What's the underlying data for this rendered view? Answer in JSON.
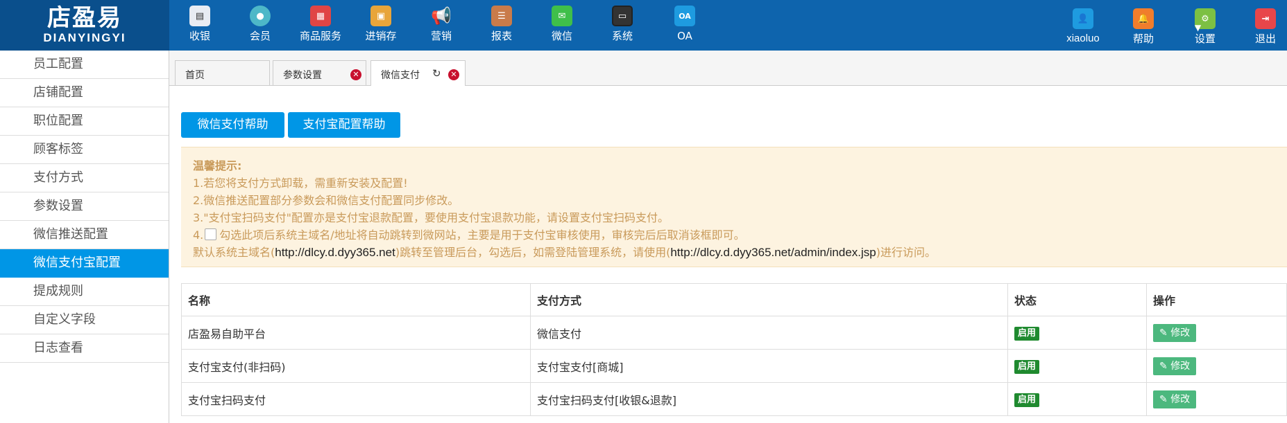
{
  "logo": {
    "cn": "店盈易",
    "en": "DIANYINGYI"
  },
  "nav": [
    {
      "label": "收银",
      "icon": "cash-register-icon",
      "color": "#4a6fa5"
    },
    {
      "label": "会员",
      "icon": "member-icon",
      "color": "#4db8c8"
    },
    {
      "label": "商品服务",
      "icon": "goods-icon",
      "color": "#e04545"
    },
    {
      "label": "进销存",
      "icon": "inventory-icon",
      "color": "#e8a53a"
    },
    {
      "label": "营销",
      "icon": "megaphone-icon",
      "color": "#ffffff"
    },
    {
      "label": "报表",
      "icon": "report-icon",
      "color": "#c97b4a"
    },
    {
      "label": "微信",
      "icon": "wechat-icon",
      "color": "#3fbf4a"
    },
    {
      "label": "系统",
      "icon": "monitor-icon",
      "color": "#333333"
    },
    {
      "label": "OA",
      "icon": "oa-icon",
      "color": "#1e9be0"
    }
  ],
  "right_nav": [
    {
      "label": "xiaoluo",
      "icon": "user-icon",
      "color": "#1e9be0"
    },
    {
      "label": "帮助",
      "icon": "bell-icon",
      "color": "#f07d2c"
    },
    {
      "label": "设置",
      "icon": "gear-icon",
      "color": "#7cc043"
    },
    {
      "label": "退出",
      "icon": "logout-icon",
      "color": "#e8464a"
    }
  ],
  "sidebar": [
    "员工配置",
    "店铺配置",
    "职位配置",
    "顾客标签",
    "支付方式",
    "参数设置",
    "微信推送配置",
    "微信支付宝配置",
    "提成规则",
    "自定义字段",
    "日志查看"
  ],
  "sidebar_active": "微信支付宝配置",
  "tabs": [
    {
      "label": "首页"
    },
    {
      "label": "参数设置"
    },
    {
      "label": "微信支付"
    }
  ],
  "buttons": {
    "wechat_help": "微信支付帮助",
    "alipay_help": "支付宝配置帮助"
  },
  "notice": {
    "title": "温馨提示:",
    "line1": "1.若您将支付方式卸载，需重新安装及配置!",
    "line2": "2.微信推送配置部分参数会和微信支付配置同步修改。",
    "line3": "3.\"支付宝扫码支付\"配置亦是支付宝退款配置，要使用支付宝退款功能，请设置支付宝扫码支付。",
    "line4_prefix": "4.",
    "line4_text": "勾选此项后系统主域名/地址将自动跳转到微网站，主要是用于支付宝审核使用，审核完后后取消该框即可。",
    "line5_a": "默认系统主域名(",
    "line5_url1": "http://dlcy.d.dyy365.net",
    "line5_b": ")跳转至管理后台，勾选后，如需登陆管理系统，请使用(",
    "line5_url2": "http://dlcy.d.dyy365.net/admin/index.jsp",
    "line5_c": ")进行访问。"
  },
  "table": {
    "headers": [
      "名称",
      "支付方式",
      "状态",
      "操作"
    ],
    "rows": [
      {
        "name": "店盈易自助平台",
        "method": "微信支付",
        "status": "启用",
        "action": "修改"
      },
      {
        "name": "支付宝支付(非扫码)",
        "method": "支付宝支付[商城]",
        "status": "启用",
        "action": "修改"
      },
      {
        "name": "支付宝扫码支付",
        "method": "支付宝扫码支付[收银&退款]",
        "status": "启用",
        "action": "修改"
      }
    ]
  }
}
